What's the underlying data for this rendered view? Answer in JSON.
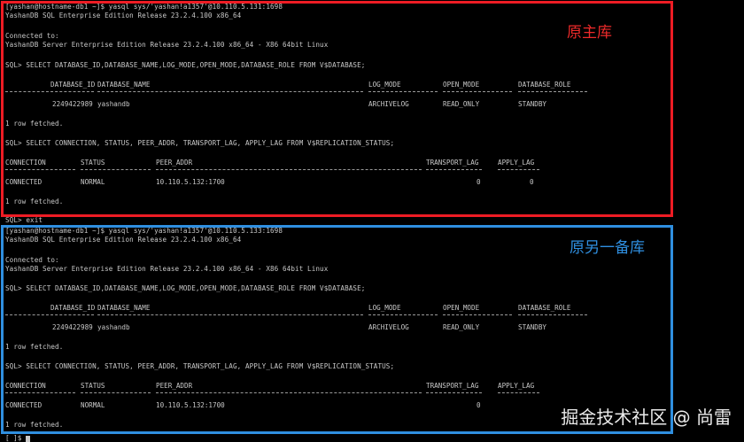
{
  "primary": {
    "prompt": "[yashan@hostname-db1 ~]$ yasql sys/'yashan!a1357'@10.110.5.131:1698",
    "release_line": "YashanDB SQL Enterprise Edition Release 23.2.4.100 x86_64",
    "connected_to": "Connected to:",
    "server_line": "YashanDB Server Enterprise Edition Release 23.2.4.100 x86_64 - X86 64bit Linux",
    "query1": "SQL> SELECT DATABASE_ID,DATABASE_NAME,LOG_MODE,OPEN_MODE,DATABASE_ROLE FROM V$DATABASE;",
    "db_headers": [
      "DATABASE_ID",
      "DATABASE_NAME",
      "LOG_MODE",
      "OPEN_MODE",
      "DATABASE_ROLE"
    ],
    "db_row": [
      "2249422989",
      "yashandb",
      "ARCHIVELOG",
      "READ_ONLY",
      "STANDBY"
    ],
    "fetched1": "1 row fetched.",
    "query2": "SQL> SELECT CONNECTION, STATUS, PEER_ADDR, TRANSPORT_LAG, APPLY_LAG FROM V$REPLICATION_STATUS;",
    "rep_headers": [
      "CONNECTION",
      "STATUS",
      "PEER_ADDR",
      "TRANSPORT_LAG",
      "APPLY_LAG"
    ],
    "rep_row": [
      "CONNECTED",
      "NORMAL",
      "10.110.5.132:1700",
      "0",
      "0"
    ],
    "fetched2": "1 row fetched."
  },
  "exit_line": "SQL> exit",
  "standby": {
    "prompt": "[yashan@hostname-db1 ~]$ yasql sys/'yashan!a1357'@10.110.5.133:1698",
    "release_line": "YashanDB SQL Enterprise Edition Release 23.2.4.100 x86_64",
    "connected_to": "Connected to:",
    "server_line": "YashanDB Server Enterprise Edition Release 23.2.4.100 x86_64 - X86 64bit Linux",
    "query1": "SQL> SELECT DATABASE_ID,DATABASE_NAME,LOG_MODE,OPEN_MODE,DATABASE_ROLE FROM V$DATABASE;",
    "db_headers": [
      "DATABASE_ID",
      "DATABASE_NAME",
      "LOG_MODE",
      "OPEN_MODE",
      "DATABASE_ROLE"
    ],
    "db_row": [
      "2249422989",
      "yashandb",
      "ARCHIVELOG",
      "READ_ONLY",
      "STANDBY"
    ],
    "fetched1": "1 row fetched.",
    "query2": "SQL> SELECT CONNECTION, STATUS, PEER_ADDR, TRANSPORT_LAG, APPLY_LAG FROM V$REPLICATION_STATUS;",
    "rep_headers": [
      "CONNECTION",
      "STATUS",
      "PEER_ADDR",
      "TRANSPORT_LAG",
      "APPLY_LAG"
    ],
    "rep_row": [
      "CONNECTED",
      "NORMAL",
      "10.110.5.132:1700",
      "0"
    ],
    "fetched2": "1 row fetched."
  },
  "annotations": {
    "primary_label": "原主库",
    "standby_label": "原另一备库",
    "primary_color": "#ee1c24",
    "standby_color": "#2f8fe0"
  },
  "watermark": "掘金技术社区 @ 尚雷",
  "cursor_prompt": "[ ]$"
}
